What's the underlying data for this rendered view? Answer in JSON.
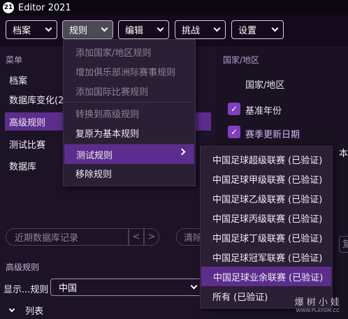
{
  "window": {
    "icon_text": "21",
    "title": "Editor 2021"
  },
  "toolbar": {
    "buttons": [
      {
        "label": "档案"
      },
      {
        "label": "规则"
      },
      {
        "label": "编辑"
      },
      {
        "label": "挑战"
      },
      {
        "label": "设置"
      }
    ]
  },
  "left": {
    "section_label": "菜单",
    "items": [
      "档案",
      "数据库变化(2",
      "高级规则",
      "测试比赛",
      "数据库"
    ],
    "selected_index": 2,
    "search_placeholder": "近期数据库记录",
    "nav_prev": "<",
    "nav_next": ">",
    "clear_label": "清除",
    "advanced_label": "高级规则",
    "show_label": "显示...规则",
    "show_value": "中国",
    "list_label": "列表"
  },
  "right": {
    "section_label": "国家/地区",
    "row1": "国家/地区",
    "check1": "基准年份",
    "check2": "赛季更新日期",
    "partial_text": "本",
    "partial_btn": "复"
  },
  "rules_menu": {
    "items": [
      {
        "label": "添加国家/地区规则",
        "disabled": true
      },
      {
        "label": "增加俱乐部洲际赛事规则",
        "disabled": true
      },
      {
        "label": "添加国际比赛规则",
        "disabled": true
      },
      {
        "label": "转换到高级规则",
        "disabled": true
      },
      {
        "label": "复原为基本规则",
        "disabled": false
      },
      {
        "label": "测试规则",
        "disabled": false,
        "submenu": true
      },
      {
        "label": "移除规则",
        "disabled": false
      }
    ]
  },
  "test_submenu": {
    "items": [
      "中国足球超级联赛 (已验证)",
      "中国足球甲级联赛 (已验证)",
      "中国足球乙级联赛 (已验证)",
      "中国足球丙级联赛 (已验证)",
      "中国足球丁级联赛 (已验证)",
      "中国足球冠军联赛 (已验证)",
      "中国足球业余联赛 (已验证)",
      "所有 (已验证)"
    ],
    "highlighted_index": 6
  },
  "watermark": {
    "text": "爆 树 小 娃",
    "url": "WWW.PLAYGM.CC"
  },
  "colors": {
    "accent": "#5c2d8c",
    "checkbox": "#7e3fc0",
    "background": "#1d1326"
  }
}
